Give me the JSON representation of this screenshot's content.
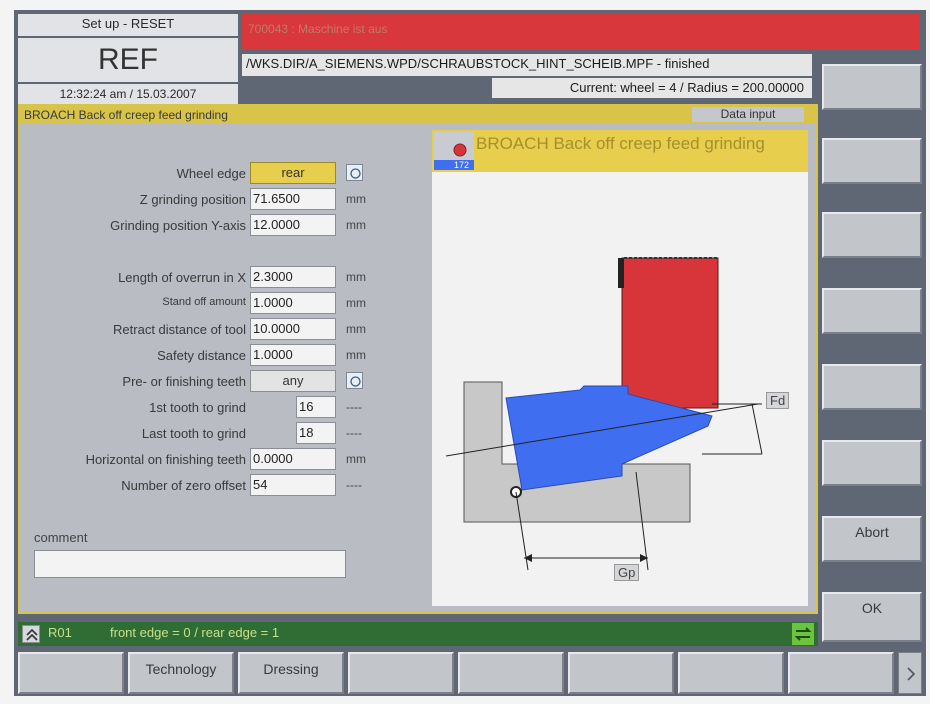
{
  "header": {
    "mode": "Set up - RESET",
    "big_mode": "REF",
    "datetime": "12:32:24 am / 15.03.2007",
    "alarm": "700043 : Maschine ist aus",
    "program_path": "/WKS.DIR/A_SIEMENS.WPD/SCHRAUBSTOCK_HINT_SCHEIB.MPF - finished",
    "current_wheel": "Current:  wheel = 4   /  Radius =  200.00000"
  },
  "window": {
    "title": "BROACH Back off creep feed grinding",
    "data_input": "Data input"
  },
  "form": {
    "wheel_edge": {
      "label": "Wheel edge",
      "value": "rear"
    },
    "z_pos": {
      "label": "Z grinding position",
      "value": "71.6500",
      "unit": "mm"
    },
    "y_pos": {
      "label": "Grinding position  Y-axis",
      "value": "12.0000",
      "unit": "mm"
    },
    "overrun": {
      "label": "Length of overrun in X",
      "value": "2.3000",
      "unit": "mm"
    },
    "standoff": {
      "label": "Stand off amount",
      "value": "1.0000",
      "unit": "mm"
    },
    "retract": {
      "label": "Retract distance of tool",
      "value": "10.0000",
      "unit": "mm"
    },
    "safety": {
      "label": "Safety distance",
      "value": "1.0000",
      "unit": "mm"
    },
    "teeth_sel": {
      "label": "Pre- or finishing teeth",
      "value": "any"
    },
    "first_tooth": {
      "label": "1st tooth to grind",
      "value": "16",
      "unit": "----"
    },
    "last_tooth": {
      "label": "Last tooth to grind",
      "value": "18",
      "unit": "----"
    },
    "horizontal": {
      "label": "Horizontal on finishing teeth",
      "value": "0.0000",
      "unit": "mm"
    },
    "zero_offset": {
      "label": "Number of zero offset",
      "value": "54",
      "unit": "----"
    },
    "comment_label": "comment",
    "comment_value": ""
  },
  "graphic": {
    "title": "BROACH Back off creep feed grinding",
    "icon_number": "172",
    "fd_label": "Fd",
    "gp_label": "Gp",
    "colors": {
      "wheel": "#d8353a",
      "part": "#3f6ff0",
      "fixture": "#c8c8c8"
    }
  },
  "vertical_softkeys": [
    "",
    "",
    "",
    "",
    "",
    "",
    "Abort",
    "OK"
  ],
  "status": {
    "param": "R01",
    "text": "front edge = 0 / rear edge  = 1"
  },
  "horizontal_softkeys": [
    "",
    "Technology",
    "Dressing",
    "",
    "",
    "",
    "",
    ""
  ]
}
